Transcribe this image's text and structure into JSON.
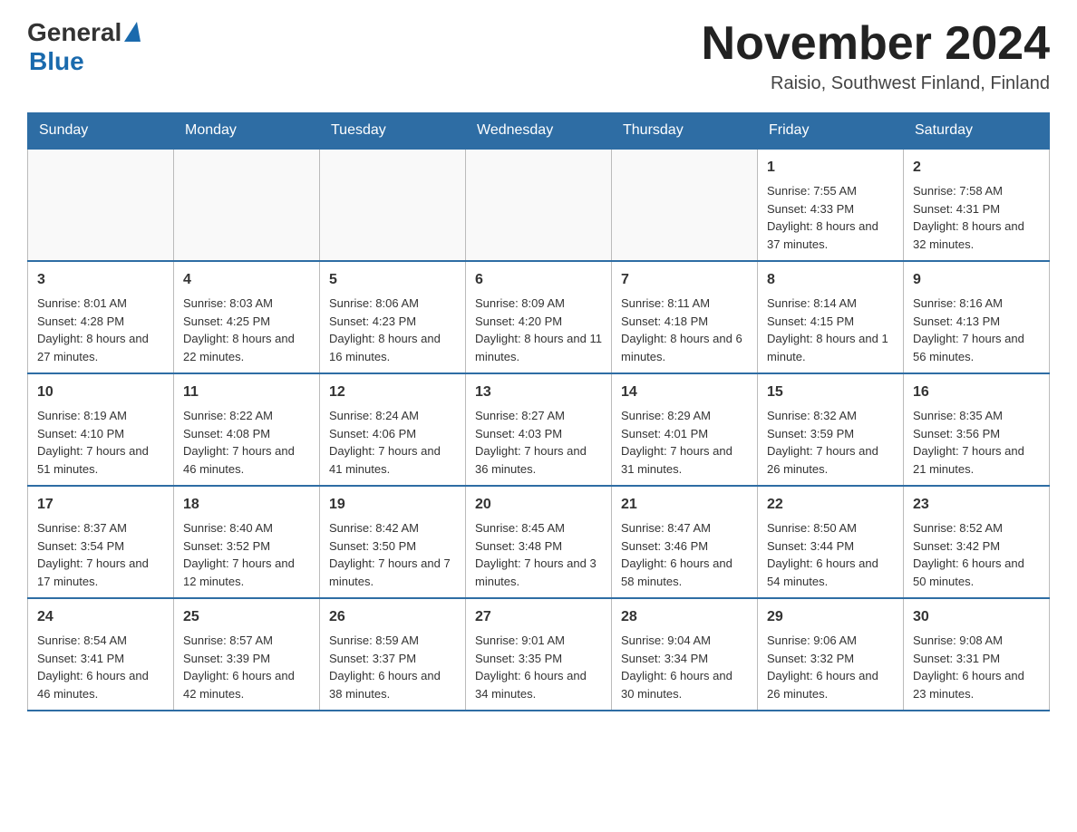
{
  "header": {
    "logo_general": "General",
    "logo_blue": "Blue",
    "month_title": "November 2024",
    "location": "Raisio, Southwest Finland, Finland"
  },
  "columns": [
    "Sunday",
    "Monday",
    "Tuesday",
    "Wednesday",
    "Thursday",
    "Friday",
    "Saturday"
  ],
  "weeks": [
    [
      {
        "day": "",
        "sunrise": "",
        "sunset": "",
        "daylight": ""
      },
      {
        "day": "",
        "sunrise": "",
        "sunset": "",
        "daylight": ""
      },
      {
        "day": "",
        "sunrise": "",
        "sunset": "",
        "daylight": ""
      },
      {
        "day": "",
        "sunrise": "",
        "sunset": "",
        "daylight": ""
      },
      {
        "day": "",
        "sunrise": "",
        "sunset": "",
        "daylight": ""
      },
      {
        "day": "1",
        "sunrise": "Sunrise: 7:55 AM",
        "sunset": "Sunset: 4:33 PM",
        "daylight": "Daylight: 8 hours and 37 minutes."
      },
      {
        "day": "2",
        "sunrise": "Sunrise: 7:58 AM",
        "sunset": "Sunset: 4:31 PM",
        "daylight": "Daylight: 8 hours and 32 minutes."
      }
    ],
    [
      {
        "day": "3",
        "sunrise": "Sunrise: 8:01 AM",
        "sunset": "Sunset: 4:28 PM",
        "daylight": "Daylight: 8 hours and 27 minutes."
      },
      {
        "day": "4",
        "sunrise": "Sunrise: 8:03 AM",
        "sunset": "Sunset: 4:25 PM",
        "daylight": "Daylight: 8 hours and 22 minutes."
      },
      {
        "day": "5",
        "sunrise": "Sunrise: 8:06 AM",
        "sunset": "Sunset: 4:23 PM",
        "daylight": "Daylight: 8 hours and 16 minutes."
      },
      {
        "day": "6",
        "sunrise": "Sunrise: 8:09 AM",
        "sunset": "Sunset: 4:20 PM",
        "daylight": "Daylight: 8 hours and 11 minutes."
      },
      {
        "day": "7",
        "sunrise": "Sunrise: 8:11 AM",
        "sunset": "Sunset: 4:18 PM",
        "daylight": "Daylight: 8 hours and 6 minutes."
      },
      {
        "day": "8",
        "sunrise": "Sunrise: 8:14 AM",
        "sunset": "Sunset: 4:15 PM",
        "daylight": "Daylight: 8 hours and 1 minute."
      },
      {
        "day": "9",
        "sunrise": "Sunrise: 8:16 AM",
        "sunset": "Sunset: 4:13 PM",
        "daylight": "Daylight: 7 hours and 56 minutes."
      }
    ],
    [
      {
        "day": "10",
        "sunrise": "Sunrise: 8:19 AM",
        "sunset": "Sunset: 4:10 PM",
        "daylight": "Daylight: 7 hours and 51 minutes."
      },
      {
        "day": "11",
        "sunrise": "Sunrise: 8:22 AM",
        "sunset": "Sunset: 4:08 PM",
        "daylight": "Daylight: 7 hours and 46 minutes."
      },
      {
        "day": "12",
        "sunrise": "Sunrise: 8:24 AM",
        "sunset": "Sunset: 4:06 PM",
        "daylight": "Daylight: 7 hours and 41 minutes."
      },
      {
        "day": "13",
        "sunrise": "Sunrise: 8:27 AM",
        "sunset": "Sunset: 4:03 PM",
        "daylight": "Daylight: 7 hours and 36 minutes."
      },
      {
        "day": "14",
        "sunrise": "Sunrise: 8:29 AM",
        "sunset": "Sunset: 4:01 PM",
        "daylight": "Daylight: 7 hours and 31 minutes."
      },
      {
        "day": "15",
        "sunrise": "Sunrise: 8:32 AM",
        "sunset": "Sunset: 3:59 PM",
        "daylight": "Daylight: 7 hours and 26 minutes."
      },
      {
        "day": "16",
        "sunrise": "Sunrise: 8:35 AM",
        "sunset": "Sunset: 3:56 PM",
        "daylight": "Daylight: 7 hours and 21 minutes."
      }
    ],
    [
      {
        "day": "17",
        "sunrise": "Sunrise: 8:37 AM",
        "sunset": "Sunset: 3:54 PM",
        "daylight": "Daylight: 7 hours and 17 minutes."
      },
      {
        "day": "18",
        "sunrise": "Sunrise: 8:40 AM",
        "sunset": "Sunset: 3:52 PM",
        "daylight": "Daylight: 7 hours and 12 minutes."
      },
      {
        "day": "19",
        "sunrise": "Sunrise: 8:42 AM",
        "sunset": "Sunset: 3:50 PM",
        "daylight": "Daylight: 7 hours and 7 minutes."
      },
      {
        "day": "20",
        "sunrise": "Sunrise: 8:45 AM",
        "sunset": "Sunset: 3:48 PM",
        "daylight": "Daylight: 7 hours and 3 minutes."
      },
      {
        "day": "21",
        "sunrise": "Sunrise: 8:47 AM",
        "sunset": "Sunset: 3:46 PM",
        "daylight": "Daylight: 6 hours and 58 minutes."
      },
      {
        "day": "22",
        "sunrise": "Sunrise: 8:50 AM",
        "sunset": "Sunset: 3:44 PM",
        "daylight": "Daylight: 6 hours and 54 minutes."
      },
      {
        "day": "23",
        "sunrise": "Sunrise: 8:52 AM",
        "sunset": "Sunset: 3:42 PM",
        "daylight": "Daylight: 6 hours and 50 minutes."
      }
    ],
    [
      {
        "day": "24",
        "sunrise": "Sunrise: 8:54 AM",
        "sunset": "Sunset: 3:41 PM",
        "daylight": "Daylight: 6 hours and 46 minutes."
      },
      {
        "day": "25",
        "sunrise": "Sunrise: 8:57 AM",
        "sunset": "Sunset: 3:39 PM",
        "daylight": "Daylight: 6 hours and 42 minutes."
      },
      {
        "day": "26",
        "sunrise": "Sunrise: 8:59 AM",
        "sunset": "Sunset: 3:37 PM",
        "daylight": "Daylight: 6 hours and 38 minutes."
      },
      {
        "day": "27",
        "sunrise": "Sunrise: 9:01 AM",
        "sunset": "Sunset: 3:35 PM",
        "daylight": "Daylight: 6 hours and 34 minutes."
      },
      {
        "day": "28",
        "sunrise": "Sunrise: 9:04 AM",
        "sunset": "Sunset: 3:34 PM",
        "daylight": "Daylight: 6 hours and 30 minutes."
      },
      {
        "day": "29",
        "sunrise": "Sunrise: 9:06 AM",
        "sunset": "Sunset: 3:32 PM",
        "daylight": "Daylight: 6 hours and 26 minutes."
      },
      {
        "day": "30",
        "sunrise": "Sunrise: 9:08 AM",
        "sunset": "Sunset: 3:31 PM",
        "daylight": "Daylight: 6 hours and 23 minutes."
      }
    ]
  ]
}
